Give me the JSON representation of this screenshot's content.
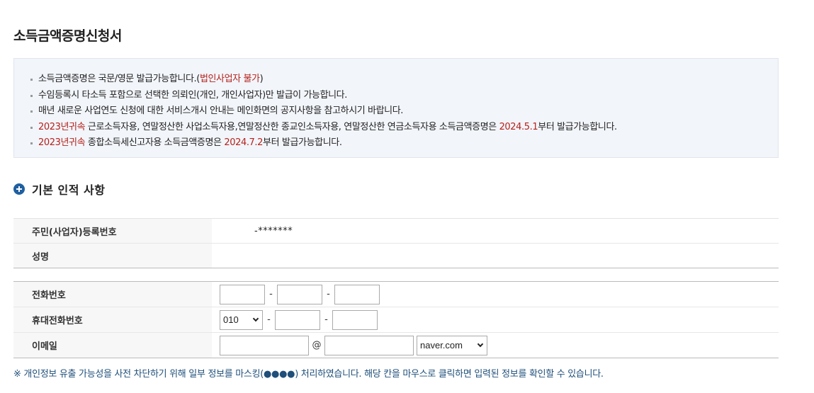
{
  "page": {
    "title": "소득금액증명신청서"
  },
  "notice": {
    "line1": {
      "text": "소득금액증명은 국문/영문 발급가능합니다.(",
      "red": "법인사업자 불가",
      "end": ")"
    },
    "line2": "수임등록시 타소득 포함으로 선택한 의뢰인(개인, 개인사업자)만 발급이 가능합니다.",
    "line3": "매년 새로운 사업연도 신청에 대한 서비스개시 안내는 메인화면의 공지사항을 참고하시기 바랍니다.",
    "line4": {
      "red1": "2023년귀속",
      "mid": " 근로소득자용, 연말정산한 사업소득자용,연말정산한 종교인소득자용, 연말정산한 연금소득자용 소득금액증명은 ",
      "red2": "2024.5.1",
      "end": "부터 발급가능합니다."
    },
    "line5": {
      "red1": "2023년귀속",
      "mid": " 종합소득세신고자용 소득금액증명은 ",
      "red2": "2024.7.2",
      "end": "부터 발급가능합니다."
    }
  },
  "section": {
    "title": "기본 인적 사항"
  },
  "identity": {
    "reg_label": "주민(사업자)등록번호",
    "reg_value": "-*******",
    "name_label": "성명",
    "name_value": ""
  },
  "contact": {
    "phone_label": "전화번호",
    "mobile_label": "휴대전화번호",
    "mobile_prefix": "010",
    "email_label": "이메일",
    "email_at": "@",
    "email_domain": "naver.com",
    "dash": "-"
  },
  "footnote": "※ 개인정보 유출 가능성을 사전 차단하기 위해 일부 정보를 마스킹(●●●●) 처리하였습니다. 해당 칸을 마우스로 클릭하면 입력된 정보를 확인할 수 있습니다."
}
